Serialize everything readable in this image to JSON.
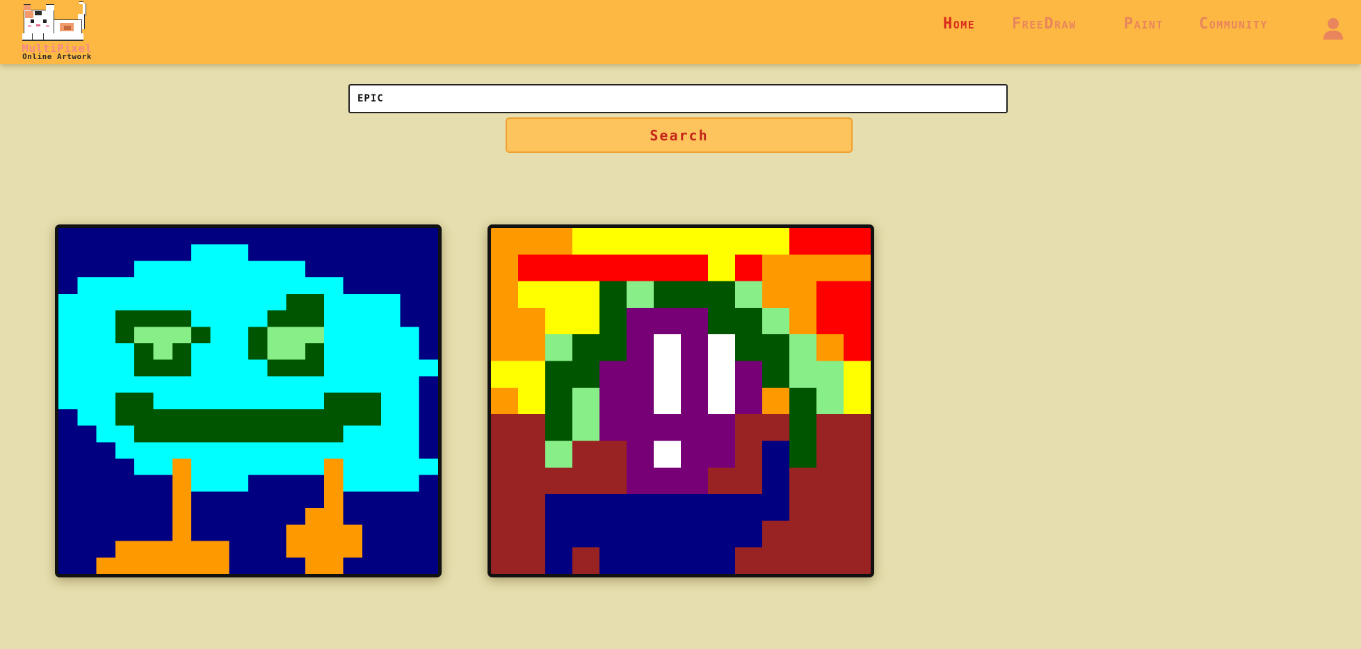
{
  "app": {
    "logo_title": "MultiPixel",
    "logo_subtitle": "Online Artwork",
    "logo_icon": "cat-icon"
  },
  "nav": {
    "items": [
      {
        "label": "Home",
        "active": true
      },
      {
        "label": "FreeDraw",
        "active": false
      },
      {
        "label": "Paint",
        "active": false
      },
      {
        "label": "Community",
        "active": false
      }
    ],
    "user_icon": "user-icon"
  },
  "search": {
    "value": "EPIC",
    "placeholder": "",
    "button_label": "Search"
  },
  "colors": {
    "background": "#e6deae",
    "header": "#fdb843",
    "nav_active": "#d82b1c",
    "nav_inactive": "#e8855d",
    "button_bg": "#fdc35d",
    "button_text": "#c4261a"
  },
  "artworks": [
    {
      "palette": {
        "N": "#000080",
        "C": "#00ffff",
        "D": "#005500",
        "L": "#88ee88",
        "O": "#ff9900"
      },
      "grid": [
        "NNNNNNNNNNNNNNNNNNNN",
        "NNNNNNNCCCNNNNNNNNNN",
        "NNNNCCCCCCCCCNNNNNNN",
        "NCCCCCCCCCCCCCCNNNNN",
        "CCCCCCCCCCCCDDCCCCNN",
        "CCCDDDDCCCCDDDCCCCNN",
        "CCCDLLLDCCDLLLCCCCCN",
        "CCCCDLDCCCDLLDCCCCCN",
        "CCCCDDDCCCCDDDCCCCCC",
        "CCCCCCCCCCCCCCCCCCCN",
        "CCCDDCCCCCCCCCDDDCCN",
        "NCCDDDDDDDDDDDDDDCCN",
        "NNCCDDDDDDDDDDDCCCCN",
        "NNNCCCCCCCCCCCCCCCCN",
        "NNNNCCOCCCCCCCOCCCCC",
        "NNNNNNOCCCNNNNOCCCCN",
        "NNNNNNONNNNNNNONNNNN",
        "NNNNNNONNNNNNOONNNNN",
        "NNNNNNONNNNNOOOONNNN",
        "NNNOOOOOONNNOOOONNNN",
        "NNOOOOOOONNNNOONNNNN"
      ]
    },
    {
      "palette": {
        "O": "#ff9900",
        "Y": "#ffff00",
        "R": "#ff0000",
        "D": "#005500",
        "L": "#88ee88",
        "P": "#770077",
        "W": "#ffffff",
        "B": "#992222",
        "N": "#000080"
      },
      "grid": [
        "OOOYYYYYYYYRR",
        "ORRRRRRRYROOO",
        "OYYYDLDDDLOOR",
        "OOYYDPPPDDLOR",
        "OOLDDPWPWDDLOR",
        "YYDDPPWPWPDLLY",
        "OYDLPPWPWPODLY",
        "BBDLPPPPPBBDB",
        "BBLBBPWPPBNDB",
        "BBBBBPPPBBNBB",
        "BBNNNNNNNNNBB",
        "BBNNNNNNNNBBB",
        "BBNBNNNNNBBBB"
      ]
    }
  ]
}
